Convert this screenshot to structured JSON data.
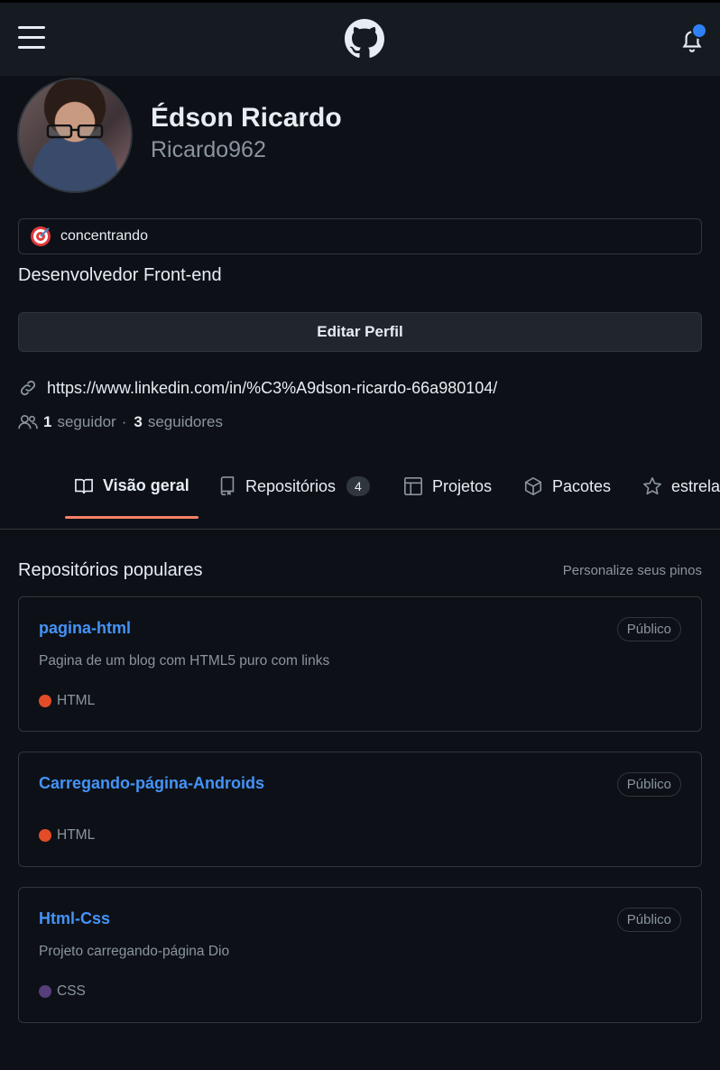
{
  "header": {
    "menu_icon": "hamburger-menu-icon",
    "logo_icon": "github-logo-icon",
    "notification_icon": "bell-icon",
    "notification_dot_color": "#2f81f7"
  },
  "profile": {
    "name": "Édson Ricardo",
    "login": "Ricardo962",
    "status_emoji": "direct-hit-target-icon",
    "status_text": "concentrando",
    "bio": "Desenvolvedor Front-end",
    "edit_button": "Editar Perfil",
    "website": "https://www.linkedin.com/in/%C3%A9dson-ricardo-66a980104/",
    "followers_count": "1",
    "followers_label": "seguidor",
    "separator": "·",
    "following_count": "3",
    "following_label": "seguidores"
  },
  "tabs": [
    {
      "label": "Visão geral",
      "icon": "book-icon",
      "active": true
    },
    {
      "label": "Repositórios",
      "icon": "repo-icon",
      "count": "4"
    },
    {
      "label": "Projetos",
      "icon": "table-icon"
    },
    {
      "label": "Pacotes",
      "icon": "package-icon"
    },
    {
      "label": "estrelas",
      "icon": "star-icon"
    }
  ],
  "pinned": {
    "title": "Repositórios populares",
    "customize": "Personalize seus pinos",
    "repos": [
      {
        "name": "pagina-html",
        "visibility": "Público",
        "description": "Pagina de um blog com HTML5 puro com links",
        "language": "HTML",
        "language_color": "#e34c26"
      },
      {
        "name": "Carregando-página-Androids",
        "visibility": "Público",
        "description": "",
        "language": "HTML",
        "language_color": "#e34c26"
      },
      {
        "name": "Html-Css",
        "visibility": "Público",
        "description": "Projeto carregando-página Dio",
        "language": "CSS",
        "language_color": "#563d7c"
      }
    ]
  },
  "colors": {
    "background": "#0d1117",
    "link": "#4493f8",
    "tab_underline": "#f78166"
  }
}
